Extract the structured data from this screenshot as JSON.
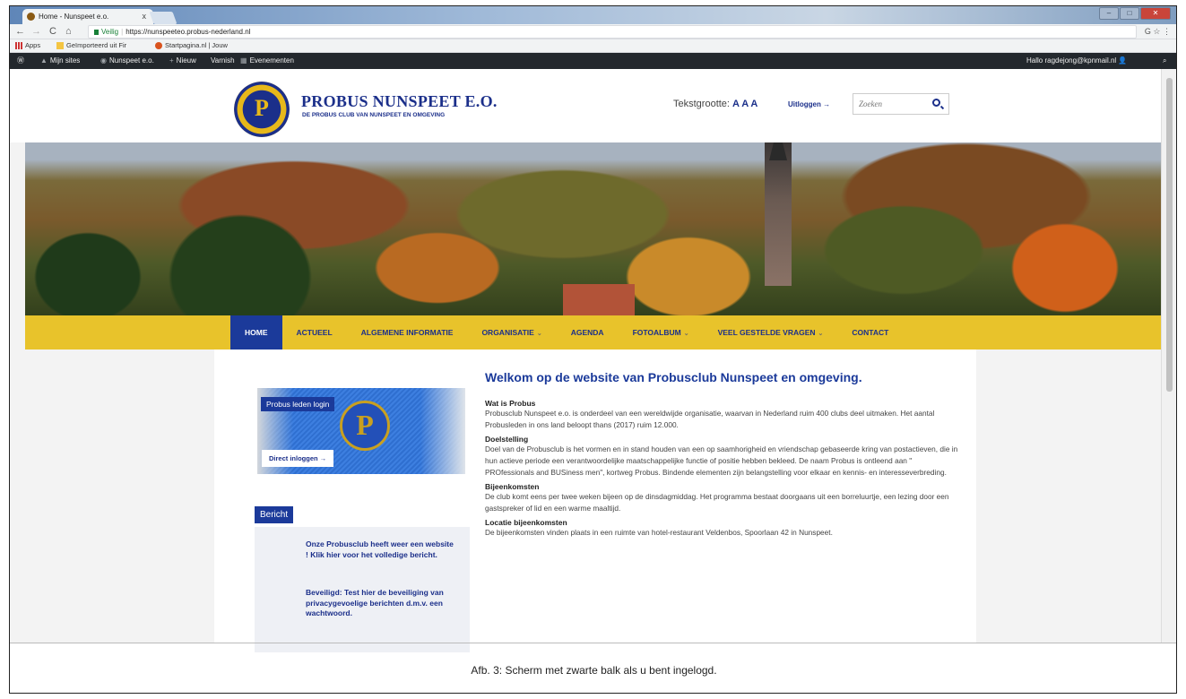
{
  "browser": {
    "tab_title": "Home - Nunspeet e.o.",
    "tab_close": "x",
    "url_secure": "Veilig",
    "url": "https://nunspeeteo.probus-nederland.nl",
    "bookmarks": [
      "Apps",
      "Geïmporteerd uit Fir",
      "Startpagina.nl | Jouw"
    ]
  },
  "wpbar": {
    "items": [
      "Mijn sites",
      "Nunspeet e.o.",
      "Nieuw",
      "Varnish",
      "Evenementen"
    ],
    "user": "Hallo ragdejong@kpnmail.nl"
  },
  "header": {
    "logo_letter": "P",
    "title": "PROBUS NUNSPEET E.O.",
    "subtitle": "DE PROBUS CLUB VAN NUNSPEET EN OMGEVING",
    "textsize_label": "Tekstgrootte:",
    "textsize_options": "A A A",
    "logout": "Uitloggen →",
    "search_placeholder": "Zoeken"
  },
  "nav": {
    "items": [
      "HOME",
      "ACTUEEL",
      "ALGEMENE INFORMATIE",
      "ORGANISATIE",
      "AGENDA",
      "FOTOALBUM",
      "VEEL GESTELDE VRAGEN",
      "CONTACT"
    ],
    "caret": "⌄"
  },
  "sidebar": {
    "login_label": "Probus leden login",
    "coin_letter": "P",
    "direct_login": "Direct inloggen →",
    "bericht_label": "Bericht",
    "news": [
      "Onze Probusclub heeft weer een website ! Klik hier voor het volledige bericht.",
      "Beveiligd: Test hier de beveiliging van privacygevoelige berichten d.m.v. een wachtwoord."
    ]
  },
  "main": {
    "title": "Welkom op de website van Probusclub Nunspeet en omgeving.",
    "sections": [
      {
        "heading": "Wat is Probus",
        "text": "Probusclub Nunspeet e.o. is onderdeel van een wereldwijde organisatie, waarvan in Nederland ruim 400 clubs deel uitmaken. Het aantal Probusleden in ons land beloopt thans (2017) ruim 12.000."
      },
      {
        "heading": "Doelstelling",
        "text": "Doel van de Probusclub is het vormen en in stand houden van een op saamhorigheid en vriendschap gebaseerde kring van postactieven, die in hun actieve periode een verantwoordelijke maatschappelijke functie of positie hebben bekleed. De naam Probus is ontleend aan \" PROfessionals and BUSiness men\", kortweg Probus. Bindende elementen zijn belangstelling voor elkaar en kennis- en interesseverbreding."
      },
      {
        "heading": "Bijeenkomsten",
        "text": "De club komt eens per twee weken bijeen op de dinsdagmiddag. Het programma bestaat doorgaans uit een borreluurtje, een lezing door een gastspreker of lid en een warme maaltijd."
      },
      {
        "heading": "Locatie bijeenkomsten",
        "text": "De bijeenkomsten vinden plaats in een ruimte van hotel-restaurant Veldenbos, Spoorlaan 42 in Nunspeet."
      }
    ]
  },
  "caption": "Afb. 3: Scherm met zwarte balk als u bent ingelogd.",
  "colors": {
    "brand_blue": "#1b2f8a",
    "nav_yellow": "#e8c32b",
    "wpbar": "#23282d"
  }
}
